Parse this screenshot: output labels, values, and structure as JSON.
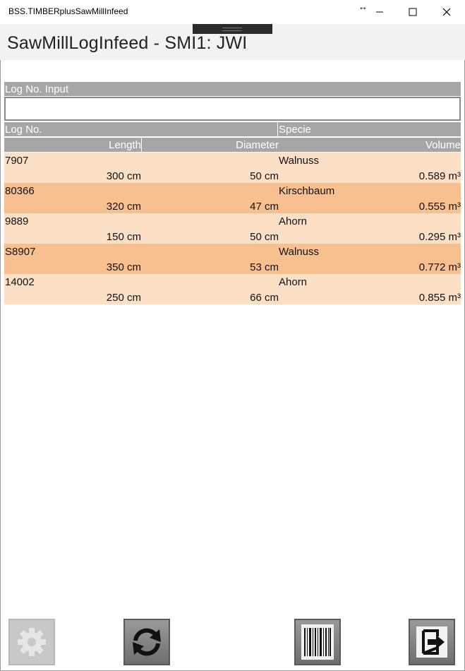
{
  "window": {
    "title": "BSS.TIMBERplusSawMillInfeed",
    "resize_glyph": "↔",
    "controls": [
      "minimize-icon",
      "maximize-icon",
      "close-icon"
    ]
  },
  "header": {
    "page_title": "SawMillLogInfeed - SMI1: JWI"
  },
  "log_input": {
    "label": "Log No. Input",
    "value": "",
    "placeholder": ""
  },
  "columns": {
    "log_no": "Log No.",
    "specie": "Specie",
    "length": "Length",
    "diameter": "Diameter",
    "volume": "Volume"
  },
  "rows": [
    {
      "log_no": "7907",
      "specie": "Walnuss",
      "length": "300 cm",
      "diameter": "50 cm",
      "volume": "0.589 m³",
      "shade": "light"
    },
    {
      "log_no": "80366",
      "specie": "Kirschbaum",
      "length": "320 cm",
      "diameter": "47 cm",
      "volume": "0.555 m³",
      "shade": "dark"
    },
    {
      "log_no": "9889",
      "specie": "Ahorn",
      "length": "150 cm",
      "diameter": "50 cm",
      "volume": "0.295 m³",
      "shade": "light"
    },
    {
      "log_no": "S8907",
      "specie": "Walnuss",
      "length": "350 cm",
      "diameter": "53 cm",
      "volume": "0.772 m³",
      "shade": "dark"
    },
    {
      "log_no": "14002",
      "specie": "Ahorn",
      "length": "250 cm",
      "diameter": "66 cm",
      "volume": "0.855 m³",
      "shade": "light"
    }
  ],
  "colors": {
    "row_light": "#fce0c6",
    "row_dark": "#f9c08f",
    "header_gray": "#a6a6a6"
  },
  "footer": {
    "buttons": [
      {
        "icon": "gear-icon",
        "enabled": false
      },
      {
        "icon": "refresh-icon",
        "enabled": true
      },
      {
        "icon": "barcode-icon",
        "enabled": true
      },
      {
        "icon": "exit-icon",
        "enabled": true
      }
    ]
  }
}
